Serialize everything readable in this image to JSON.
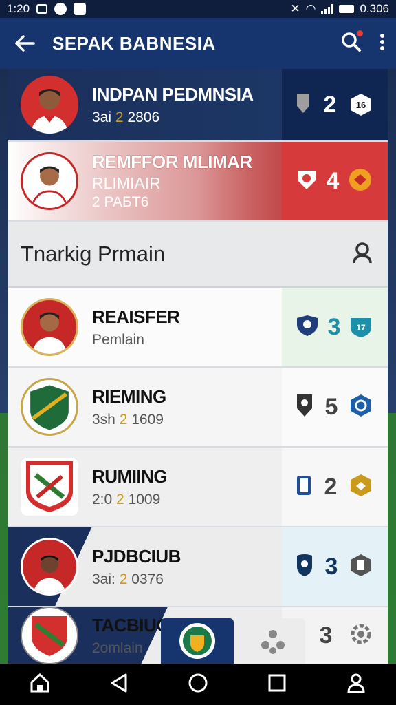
{
  "status_bar": {
    "time": "1:20",
    "battery_text": "0.306"
  },
  "app_bar": {
    "title": "SEPAK BABNESIA"
  },
  "rows_top": [
    {
      "name": "INDPAN PEDMNSIA",
      "sub_a": "3ai",
      "sub_hl": "2",
      "sub_b": "2806",
      "score": "2",
      "badge": "16"
    },
    {
      "name": "REMFFOR MLIMAR",
      "name2": "RLIMIAIR",
      "sub_a": "2 PAБT6",
      "score": "4"
    }
  ],
  "section": {
    "label": "Tnarkig Prmain"
  },
  "rows": [
    {
      "name": "REAISFER",
      "sub_a": "Pemlain",
      "score": "3",
      "badge": "17"
    },
    {
      "name": "RIEMING",
      "sub_a": "3sh",
      "sub_hl": "2",
      "sub_b": "1609",
      "score": "5"
    },
    {
      "name": "RUMIING",
      "sub_a": "2:0",
      "sub_hl": "2",
      "sub_b": "1009",
      "score": "2"
    },
    {
      "name": "PJDBCIUB",
      "sub_a": "3ai:",
      "sub_hl": "2",
      "sub_b": "0376",
      "score": "3"
    },
    {
      "name": "TACBIUO",
      "sub_a": "2omlain",
      "score": "3"
    }
  ],
  "colors": {
    "primary": "#16356e",
    "accent_red": "#d63a3a",
    "gold": "#c99a1c",
    "teal": "#1d8fa8"
  }
}
